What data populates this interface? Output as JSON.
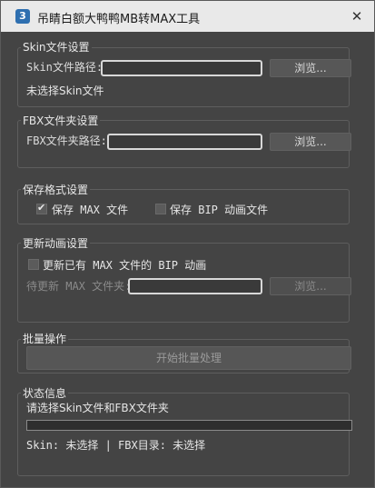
{
  "window": {
    "icon_glyph": "3",
    "title": "吊睛白额大鸭鸭MB转MAX工具",
    "close_glyph": "✕"
  },
  "skin_group": {
    "title": "Skin文件设置",
    "path_label": "Skin文件路径:",
    "path_value": "",
    "browse_label": "浏览...",
    "status": "未选择Skin文件"
  },
  "fbx_group": {
    "title": "FBX文件夹设置",
    "path_label": "FBX文件夹路径:",
    "path_value": "",
    "browse_label": "浏览..."
  },
  "save_group": {
    "title": "保存格式设置",
    "save_max_label": "保存 MAX 文件",
    "save_max_checked": true,
    "save_bip_label": "保存 BIP 动画文件",
    "save_bip_checked": false
  },
  "update_group": {
    "title": "更新动画设置",
    "update_label": "更新已有 MAX 文件的 BIP 动画",
    "update_checked": false,
    "pending_label": "待更新 MAX 文件夹:",
    "pending_value": "",
    "browse_label": "浏览..."
  },
  "batch_group": {
    "title": "批量操作",
    "start_label": "开始批量处理"
  },
  "status_group": {
    "title": "状态信息",
    "message": "请选择Skin文件和FBX文件夹",
    "progress_percent": 0,
    "summary": "Skin: 未选择 | FBX目录: 未选择"
  }
}
